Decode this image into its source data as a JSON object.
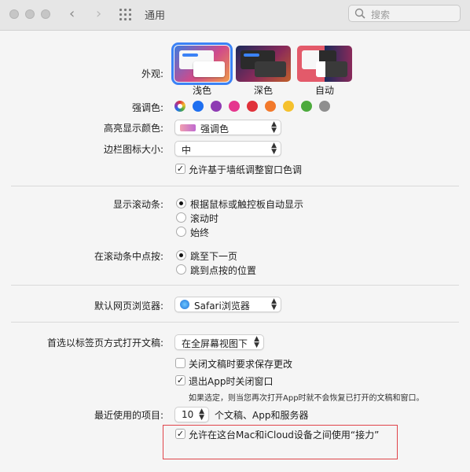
{
  "window": {
    "title": "通用",
    "search_placeholder": "搜索"
  },
  "appearance": {
    "label": "外观:",
    "options": [
      {
        "label": "浅色",
        "selected": true
      },
      {
        "label": "深色",
        "selected": false
      },
      {
        "label": "自动",
        "selected": false
      }
    ]
  },
  "accent": {
    "label": "强调色:",
    "colors": [
      "multicolor",
      "#1e6ff0",
      "#8e3bb3",
      "#e5368e",
      "#e0323a",
      "#f2792b",
      "#f5c12d",
      "#4caa3c",
      "#8e8e8e"
    ]
  },
  "highlight": {
    "label": "高亮显示颜色:",
    "value": "强调色"
  },
  "sidebar_icon": {
    "label": "边栏图标大小:",
    "value": "中"
  },
  "wallpaper_tint": {
    "label": "允许基于墙纸调整窗口色调",
    "checked": true
  },
  "scrollbars": {
    "label": "显示滚动条:",
    "options": [
      "根据鼠标或触控板自动显示",
      "滚动时",
      "始终"
    ],
    "selected_index": 0
  },
  "click_scroll": {
    "label": "在滚动条中点按:",
    "options": [
      "跳至下一页",
      "跳到点按的位置"
    ],
    "selected_index": 0
  },
  "browser": {
    "label": "默认网页浏览器:",
    "value": "Safari浏览器"
  },
  "tabs": {
    "label": "首选以标签页方式打开文稿:",
    "value": "在全屏幕视图下"
  },
  "ask_save": {
    "label": "关闭文稿时要求保存更改",
    "checked": false
  },
  "close_windows": {
    "label": "退出App时关闭窗口",
    "checked": true,
    "note": "如果选定，则当您再次打开App时就不会恢复已打开的文稿和窗口。"
  },
  "recent": {
    "label": "最近使用的项目:",
    "value": "10",
    "suffix": "个文稿、App和服务器"
  },
  "handoff": {
    "label": "允许在这台Mac和iCloud设备之间使用“接力”",
    "checked": true
  },
  "check_glyph": "✓"
}
